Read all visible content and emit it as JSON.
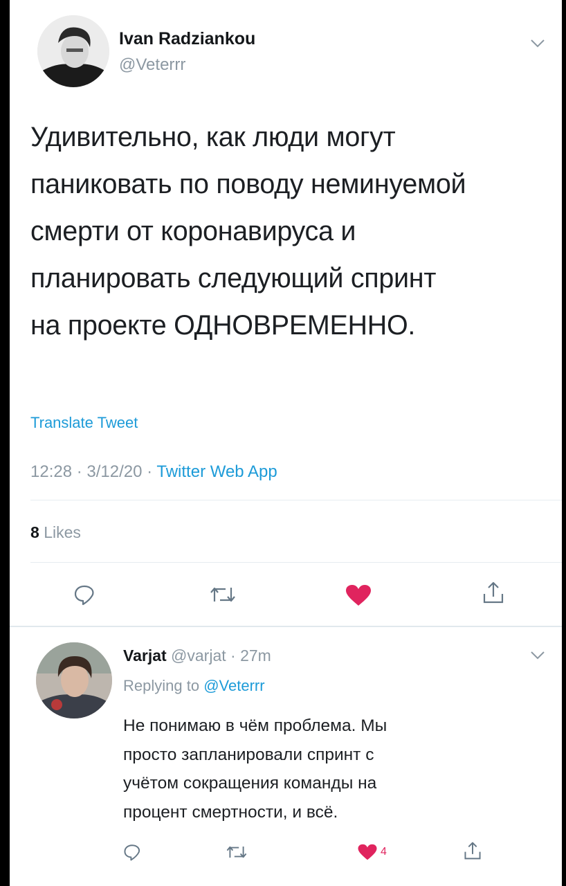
{
  "tweet": {
    "author_name": "Ivan Radzіankou",
    "author_handle": "@Veterrr",
    "text_lines": [
      "Удивительно, как люди могут",
      "паниковать по поводу неминуемой",
      "смерти от коронавируса и",
      "планировать следующий спринт",
      "на проекте ОДНОВРЕМЕННО."
    ],
    "translate_label": "Translate Tweet",
    "time": "12:28",
    "date": "3/12/20",
    "app": "Twitter Web App",
    "likes_count": "8",
    "likes_label": "Likes",
    "actions": [
      "reply-icon",
      "retweet-icon",
      "like-heart-icon",
      "share-icon"
    ]
  },
  "reply": {
    "author_name": "Varjat",
    "author_handle": "@varjat",
    "age": "27m",
    "replying_prefix": "Replying to",
    "replying_mention": "@Veterrr",
    "text_lines": [
      "Не понимаю в чём проблема. Мы",
      "просто запланировали спринт с",
      "учётом сокращения команды на",
      "процент смертности, и всё."
    ],
    "like_count": "4",
    "actions": [
      "reply-icon",
      "retweet-icon",
      "like-heart-icon",
      "share-icon"
    ]
  },
  "colors": {
    "link_blue": "#1d9bd8",
    "muted_gray": "#8c98a2",
    "like_red": "#e0245e"
  }
}
